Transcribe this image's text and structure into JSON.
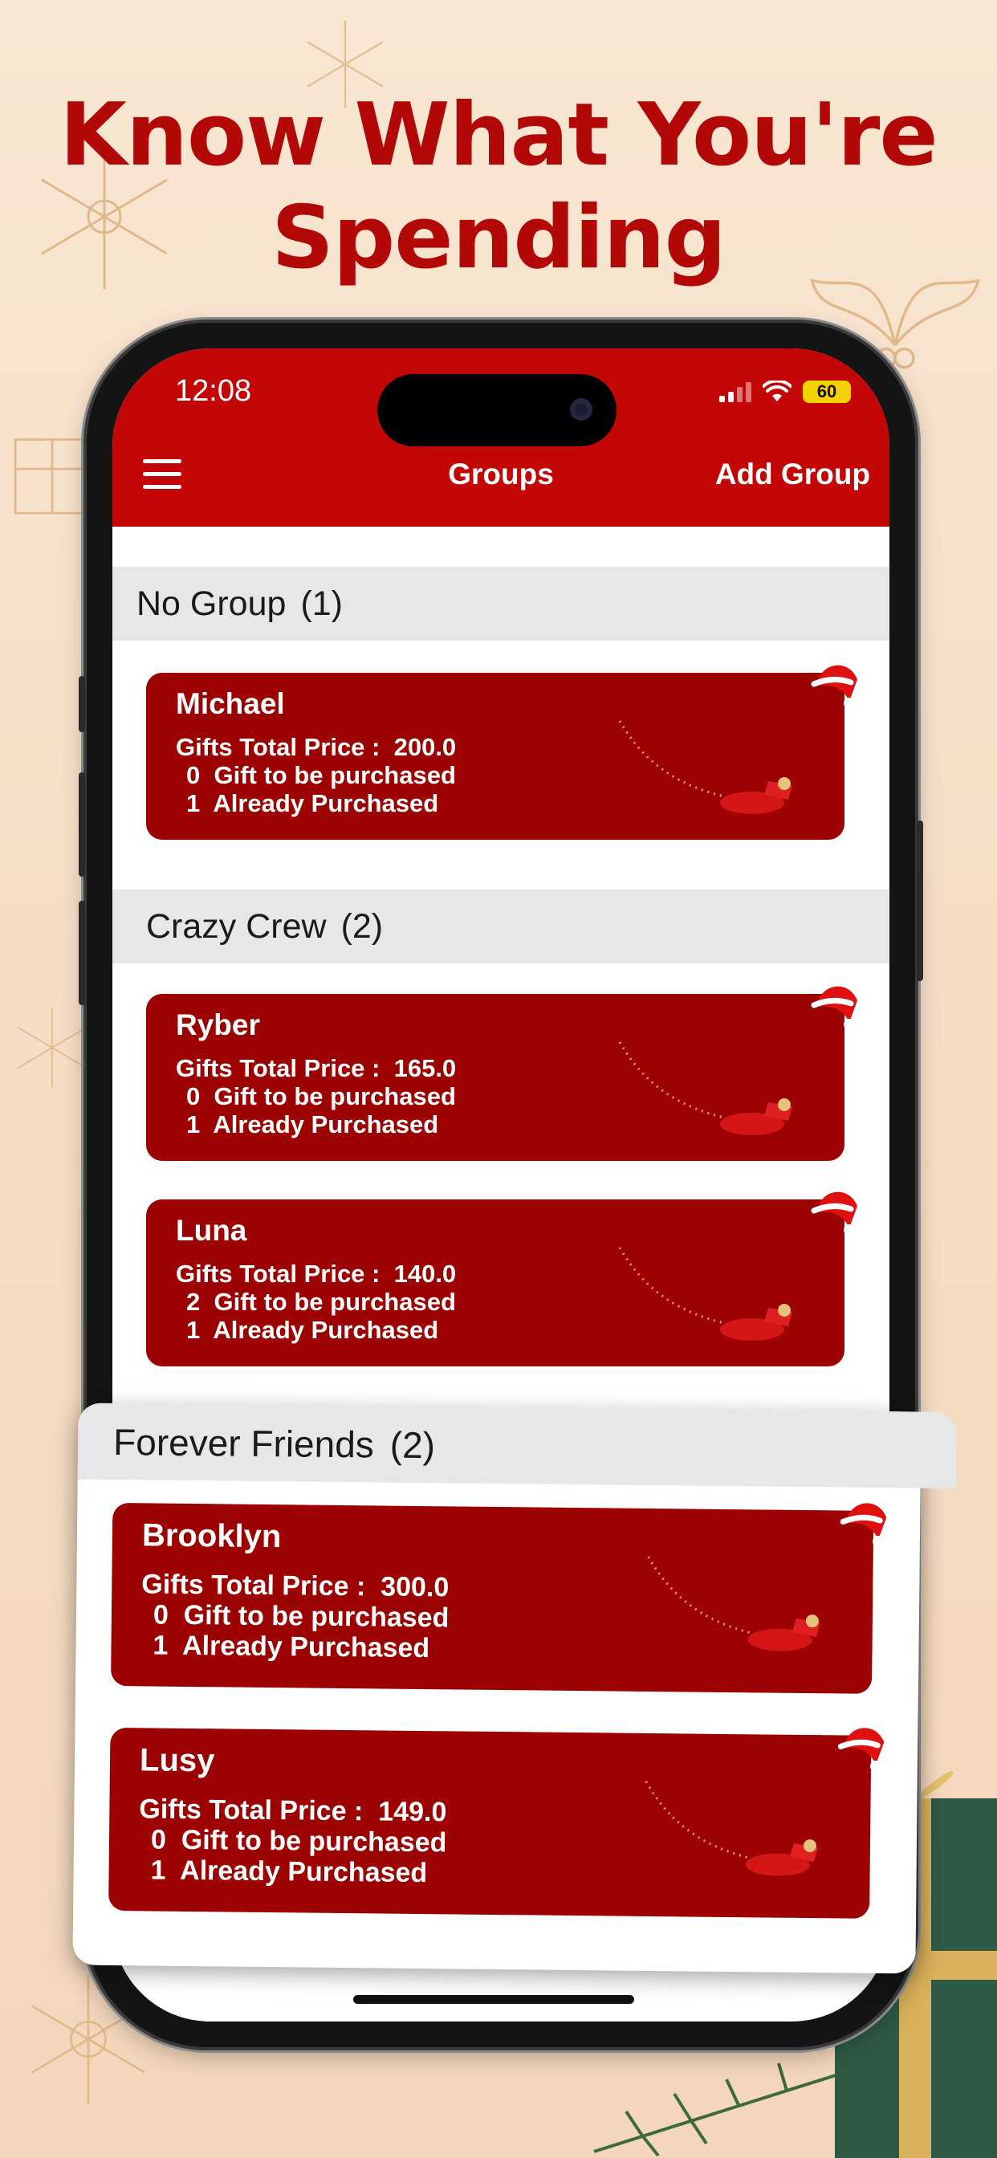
{
  "headline": {
    "line1": "Know What You're",
    "line2": "Spending"
  },
  "status_bar": {
    "time": "12:08",
    "battery": "60"
  },
  "app_bar": {
    "title": "Groups",
    "add_label": "Add Group"
  },
  "card_labels": {
    "price_label": "Gifts Total Price :",
    "to_purchase_label": "Gift to be purchased",
    "purchased_label": "Already Purchased"
  },
  "groups": [
    {
      "title": "No Group",
      "count": "(1)",
      "people": [
        {
          "name": "Michael",
          "total_price": "200.0",
          "to_purchase": "0",
          "purchased": "1"
        }
      ]
    },
    {
      "title": "Crazy Crew",
      "count": "(2)",
      "people": [
        {
          "name": "Ryber",
          "total_price": "165.0",
          "to_purchase": "0",
          "purchased": "1"
        },
        {
          "name": "Luna",
          "total_price": "140.0",
          "to_purchase": "2",
          "purchased": "1"
        }
      ]
    },
    {
      "title": "Forever Friends",
      "count": "(2)",
      "people": [
        {
          "name": "Brooklyn",
          "total_price": "300.0",
          "to_purchase": "0",
          "purchased": "1"
        },
        {
          "name": "Lusy",
          "total_price": "149.0",
          "to_purchase": "0",
          "purchased": "1"
        }
      ]
    }
  ],
  "colors": {
    "headline": "#b30808",
    "app_bar": "#c30606",
    "card": "#9d0202",
    "group_header": "#e7e7e9"
  }
}
